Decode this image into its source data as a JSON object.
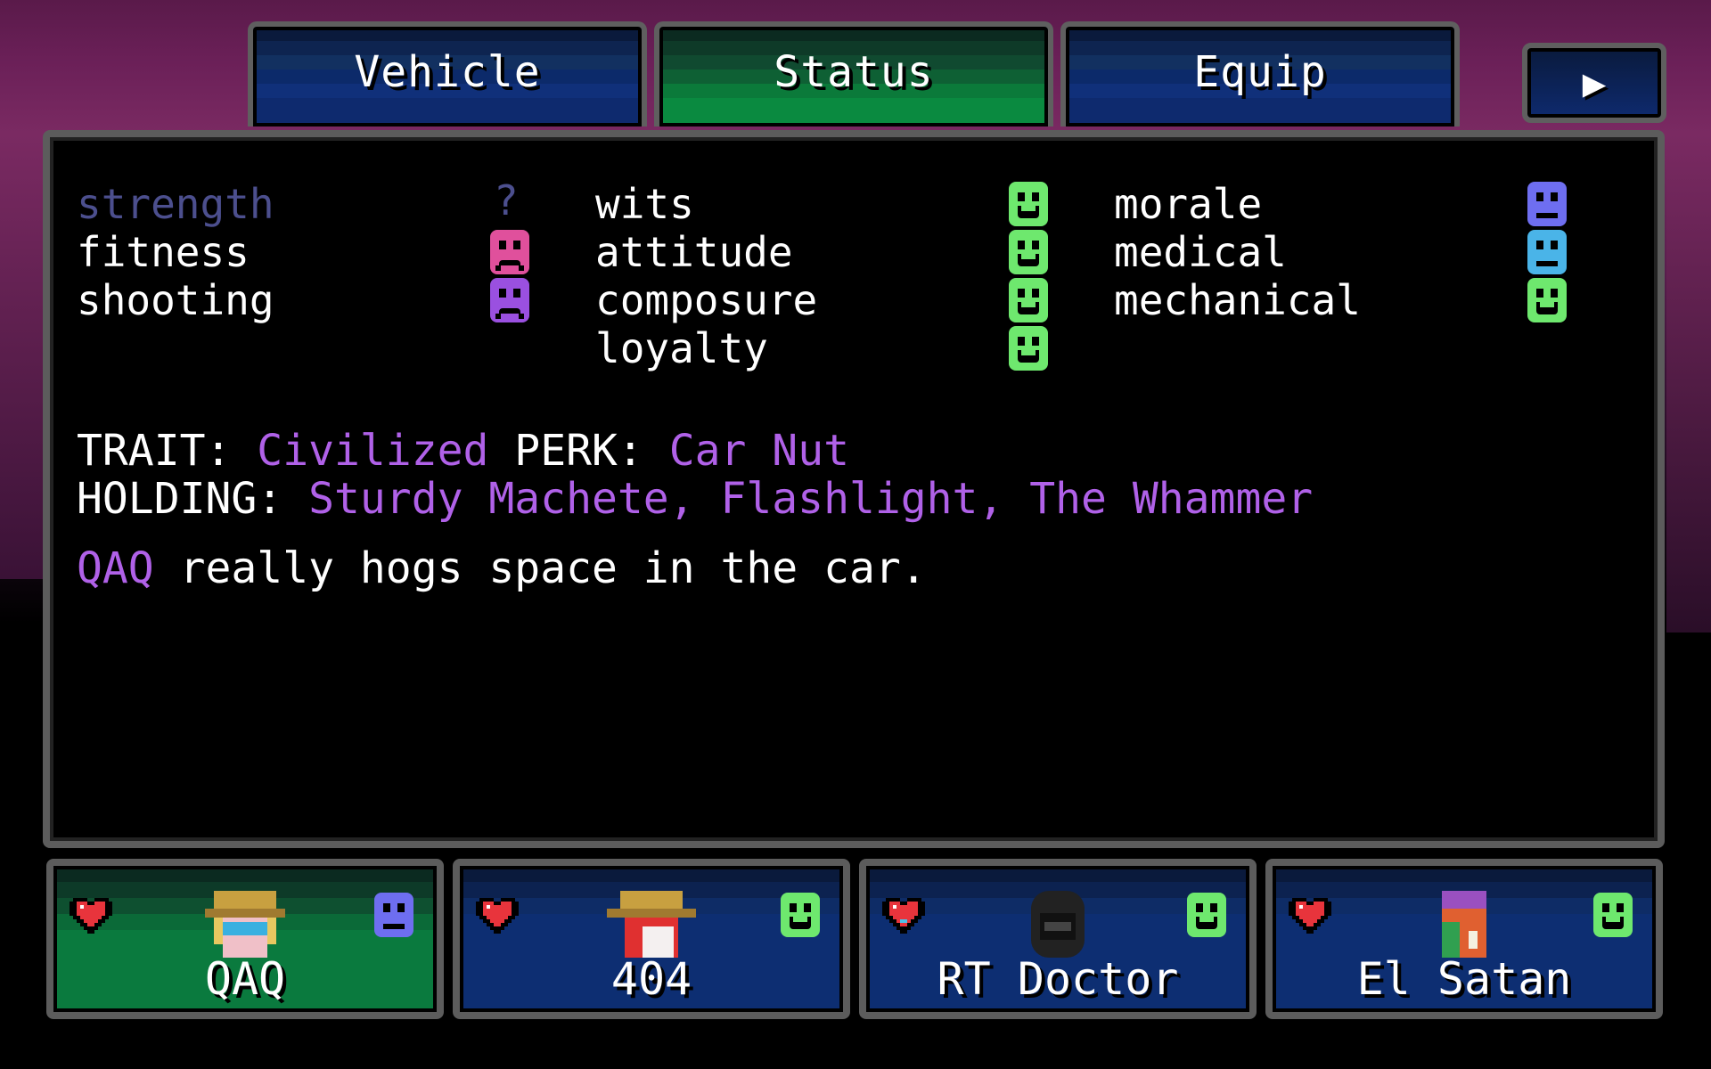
{
  "tabs": [
    {
      "label": "Vehicle",
      "active": false
    },
    {
      "label": "Status",
      "active": true
    },
    {
      "label": "Equip",
      "active": false
    }
  ],
  "next_button": {
    "icon": "play-arrow-icon",
    "glyph": "▶"
  },
  "stats": {
    "col1": [
      {
        "label": "strength",
        "mood": "unknown",
        "value_text": "?"
      },
      {
        "label": "fitness",
        "mood": "sad",
        "color": "#e0509c"
      },
      {
        "label": "shooting",
        "mood": "sad",
        "color": "#9a50e0"
      }
    ],
    "col2": [
      {
        "label": "wits",
        "mood": "happy",
        "color": "#6ee86e"
      },
      {
        "label": "attitude",
        "mood": "happy",
        "color": "#6ee86e"
      },
      {
        "label": "composure",
        "mood": "happy",
        "color": "#6ee86e"
      },
      {
        "label": "loyalty",
        "mood": "happy",
        "color": "#6ee86e"
      }
    ],
    "col3": [
      {
        "label": "morale",
        "mood": "neutral",
        "color": "#6e6ef0"
      },
      {
        "label": "medical",
        "mood": "neutral",
        "color": "#4ab4e8"
      },
      {
        "label": "mechanical",
        "mood": "happy",
        "color": "#6ee86e"
      }
    ]
  },
  "info": {
    "trait_label": "TRAIT:",
    "trait_value": "Civilized",
    "perk_label": "PERK:",
    "perk_value": "Car Nut",
    "holding_label": "HOLDING:",
    "holding_value": "Sturdy Machete, Flashlight, The Whammer",
    "note_name": "QAQ",
    "note_text": "really hogs space in the car."
  },
  "party": [
    {
      "name": "QAQ",
      "active": true,
      "mood": "neutral",
      "mood_color": "#6e6ef0",
      "portrait": "blonde-hat-portrait"
    },
    {
      "name": "404",
      "active": false,
      "mood": "happy",
      "mood_color": "#6ee86e",
      "portrait": "redhead-hat-portrait"
    },
    {
      "name": "RT Doctor",
      "active": false,
      "mood": "happy",
      "mood_color": "#6ee86e",
      "portrait": "dark-hood-portrait"
    },
    {
      "name": "El Satan",
      "active": false,
      "mood": "happy",
      "mood_color": "#6ee86e",
      "portrait": "masked-portrait"
    }
  ],
  "colors": {
    "accent_purple": "#b061e8",
    "tab_active_green": "#0a8a40",
    "tab_blue": "#0e2a6e",
    "frame_gray": "#5c5c5c"
  }
}
